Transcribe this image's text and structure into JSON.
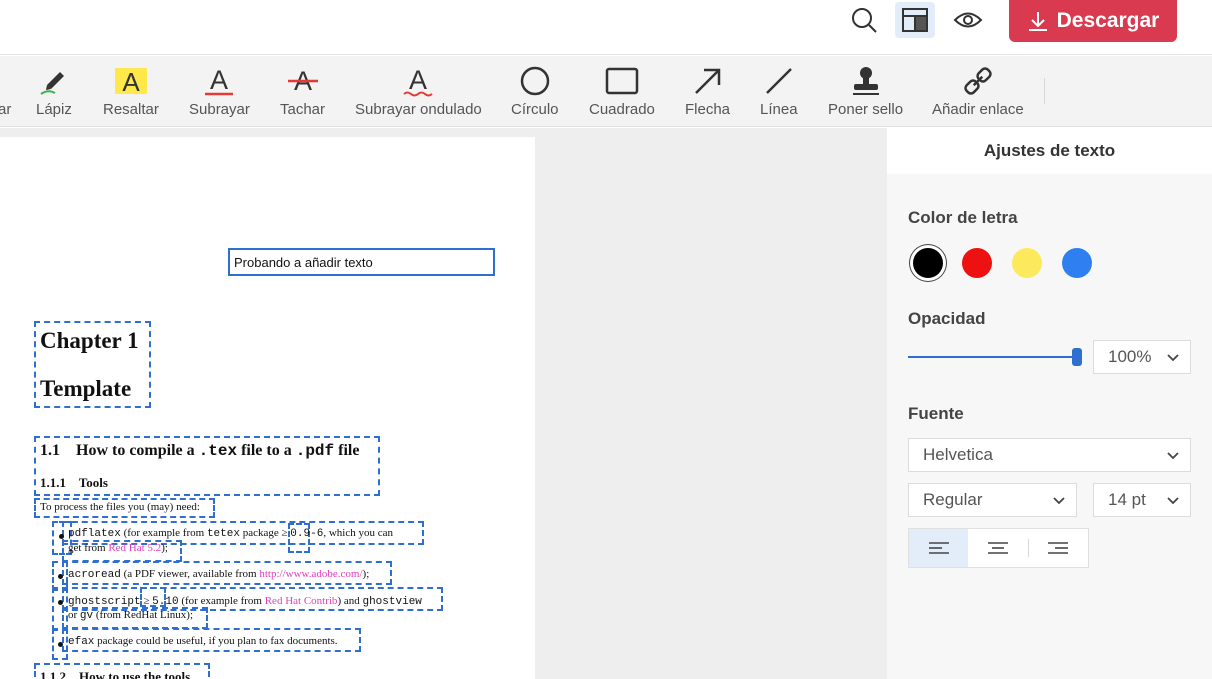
{
  "header": {
    "download_label": "Descargar",
    "icons": [
      "search-icon",
      "layout-icon",
      "eye-icon"
    ]
  },
  "toolbar": {
    "partial_label": "ar",
    "tools": [
      {
        "label": "Lápiz",
        "icon": "pencil-icon"
      },
      {
        "label": "Resaltar",
        "icon": "highlight-icon"
      },
      {
        "label": "Subrayar",
        "icon": "underline-icon"
      },
      {
        "label": "Tachar",
        "icon": "strikethrough-icon"
      },
      {
        "label": "Subrayar ondulado",
        "icon": "wavy-underline-icon"
      },
      {
        "label": "Círculo",
        "icon": "circle-icon"
      },
      {
        "label": "Cuadrado",
        "icon": "square-icon"
      },
      {
        "label": "Flecha",
        "icon": "arrow-icon"
      },
      {
        "label": "Línea",
        "icon": "line-icon"
      },
      {
        "label": "Poner sello",
        "icon": "stamp-icon"
      },
      {
        "label": "Añadir enlace",
        "icon": "link-icon"
      }
    ]
  },
  "document": {
    "added_text": "Probando a añadir texto",
    "chapter_label": "Chapter 1",
    "chapter_title": "Template",
    "section_num": "1.1",
    "section_pre": "How to compile a",
    "section_tex": ".tex",
    "section_mid": "file to a",
    "section_pdf": ".pdf",
    "section_post": "file",
    "subsection_num": "1.1.1",
    "subsection_title": "Tools",
    "intro": "To process the files you (may) need:",
    "item1_code1": "pdflatex",
    "item1_text1": "(for example from",
    "item1_code2": "tetex",
    "item1_text2": "package",
    "item1_geq": "≥",
    "item1_code3": "0.9-6",
    "item1_text3": ", which you can",
    "item1_line2_pre": "get from",
    "item1_link": "Red Hat 5.2",
    "item1_line2_post": ");",
    "item2_code": "acroread",
    "item2_text": "(a PDF viewer, available from",
    "item2_link": "http://www.adobe.com/",
    "item2_post": ");",
    "item3_code1": "ghostscript",
    "item3_geq": "≥",
    "item3_code2": "5.10",
    "item3_text1": "(for example from",
    "item3_link": "Red Hat Contrib",
    "item3_text2": ") and",
    "item3_code3": "ghostview",
    "item3_line2_pre": "or",
    "item3_code4": "gv",
    "item3_line2_post": "(from RedHat Linux);",
    "item4_code": "efax",
    "item4_text": "package could be useful, if you plan to fax documents.",
    "next_subsection_num": "1.1.2",
    "next_subsection_title": "How to use the tools"
  },
  "panel": {
    "title": "Ajustes de texto",
    "color_label": "Color de letra",
    "colors": [
      "#000000",
      "#ee1111",
      "#fde95c",
      "#2f7ff0"
    ],
    "selected_color": "#000000",
    "opacity_label": "Opacidad",
    "opacity_value": "100%",
    "font_label": "Fuente",
    "font_family": "Helvetica",
    "font_style": "Regular",
    "font_size": "14 pt",
    "alignment": [
      "left",
      "center",
      "right"
    ],
    "selected_alignment": "left"
  },
  "colors": {
    "accent": "#2f6fcf",
    "download": "#d93a4f",
    "link_pink": "#e040c0"
  }
}
